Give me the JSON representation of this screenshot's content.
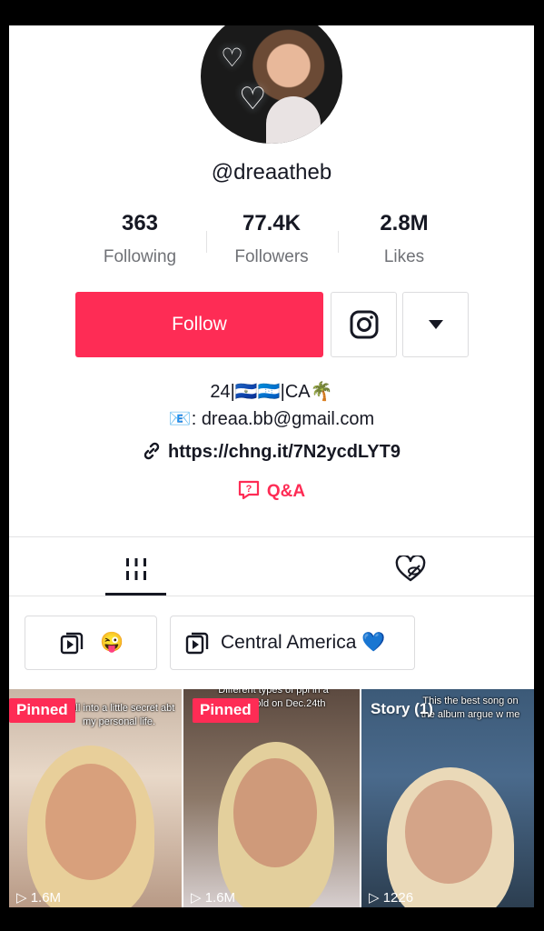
{
  "profile": {
    "username": "@dreaatheb",
    "stats": [
      {
        "value": "363",
        "label": "Following"
      },
      {
        "value": "77.4K",
        "label": "Followers"
      },
      {
        "value": "2.8M",
        "label": "Likes"
      }
    ],
    "bio_line1": "24|🇸🇻🇭🇳|CA🌴",
    "bio_line2": "📧: dreaa.bb@gmail.com",
    "link": "https://chng.it/7N2ycdLYT9",
    "qa_label": "Q&A"
  },
  "actions": {
    "follow_label": "Follow",
    "instagram_icon": "instagram-icon",
    "more_icon": "dropdown-triangle-icon"
  },
  "tabs": [
    {
      "icon": "videos-grid-icon",
      "active": true
    },
    {
      "icon": "liked-hidden-icon",
      "active": false
    }
  ],
  "playlists": [
    {
      "icon": "playlist-icon",
      "label": "😜"
    },
    {
      "icon": "playlist-icon",
      "label": "Central America 💙"
    }
  ],
  "videos": [
    {
      "badge": "Pinned",
      "caption": "y'all into a little secret abt my personal life.",
      "views": "▷ 1.6M"
    },
    {
      "badge": "Pinned",
      "caption": "Different types of ppl in a Household on Dec.24th",
      "views": "▷ 1.6M"
    },
    {
      "badge": "Story (1)",
      "caption": "This the best song on the album argue w me",
      "views": "▷ 1226"
    }
  ],
  "colors": {
    "accent": "#fe2c55",
    "text": "#161823",
    "muted": "#6f7176"
  }
}
